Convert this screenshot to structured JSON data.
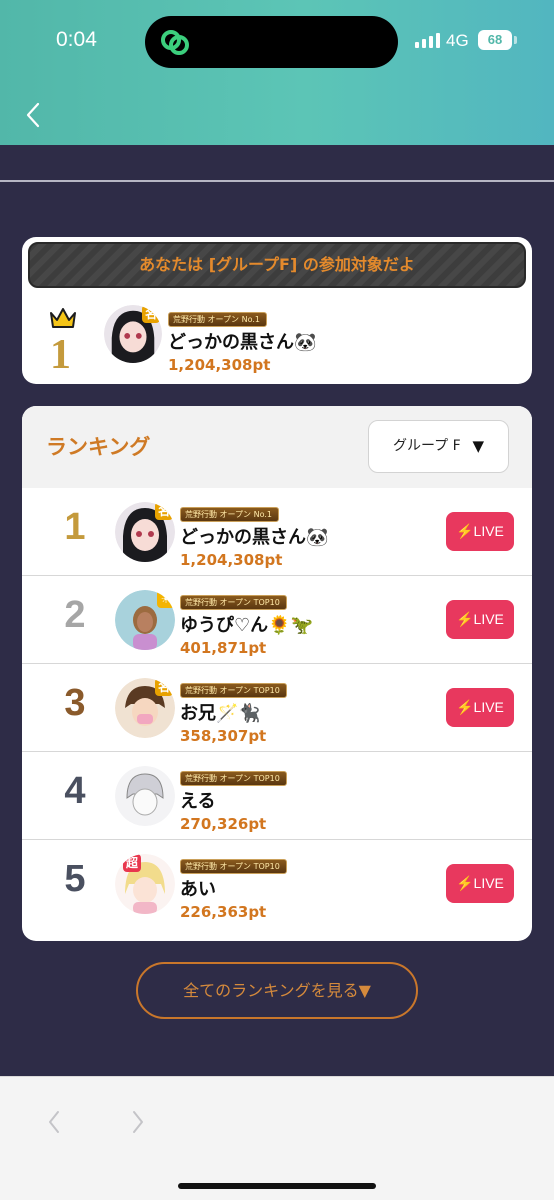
{
  "status": {
    "time": "0:04",
    "network": "4G",
    "battery": "68"
  },
  "my_entry": {
    "banner": "あなたは [グループF] の参加対象だよ",
    "rank": "1",
    "badge_tag": "荒野行動 オープン No.1",
    "name": "どっかの黒さん🐼",
    "points": "1,204,308pt"
  },
  "ranking": {
    "title": "ランキング",
    "group_label": "グループ F",
    "group_arrow": "▼",
    "live_label": "LIVE",
    "rows": [
      {
        "rank": "1",
        "name": "どっかの黒さん🐼",
        "points": "1,204,308pt",
        "tag": "荒野行動 オープン No.1",
        "avatar_badge": "名",
        "live": true
      },
      {
        "rank": "2",
        "name": "ゆうぴ♡ん🌻🦖",
        "points": "401,871pt",
        "tag": "荒野行動 オープン TOP10",
        "avatar_badge": "☀",
        "live": true
      },
      {
        "rank": "3",
        "name": "お兄🪄🐈‍⬛",
        "points": "358,307pt",
        "tag": "荒野行動 オープン TOP10",
        "avatar_badge": "名",
        "live": true
      },
      {
        "rank": "4",
        "name": "える",
        "points": "270,326pt",
        "tag": "荒野行動 オープン TOP10",
        "avatar_badge": "",
        "live": false
      },
      {
        "rank": "5",
        "name": "あい",
        "points": "226,363pt",
        "tag": "荒野行動 オープン TOP10",
        "avatar_badge": "超",
        "live": true
      }
    ]
  },
  "view_all_label": "全てのランキングを見る▼",
  "colors": {
    "header_teal": "#5cc5b6",
    "background": "#2e2c47",
    "accent_orange": "#d2761f",
    "live_red": "#e8385e",
    "gold": "#c49a3c",
    "silver": "#a6a6a6",
    "bronze": "#8a5a2b",
    "grey_rank": "#4a5060"
  }
}
